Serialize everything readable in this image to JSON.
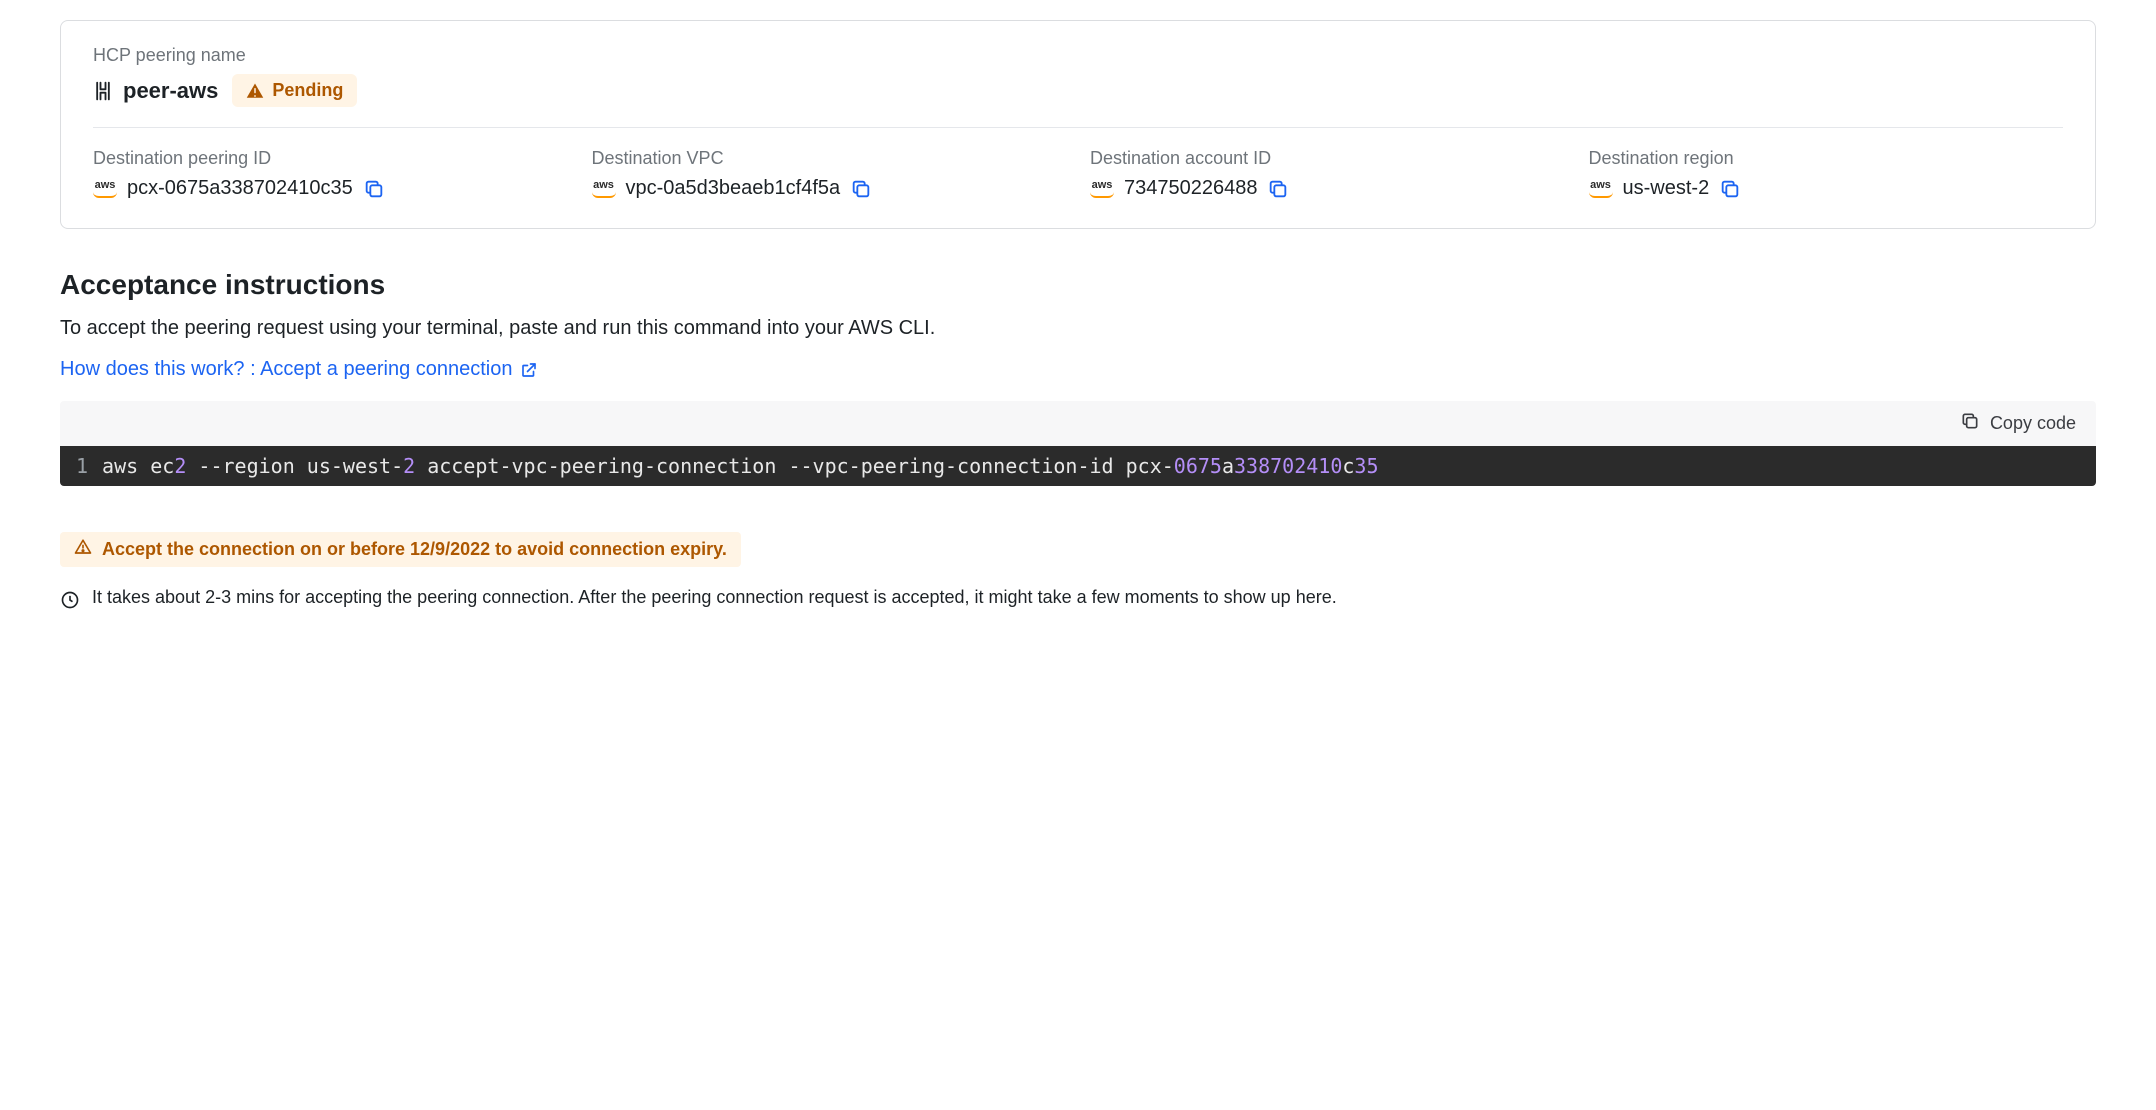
{
  "peering": {
    "name_label": "HCP peering name",
    "name": "peer-aws",
    "status": "Pending",
    "fields": {
      "destination_peering_id": {
        "label": "Destination peering ID",
        "value": "pcx-0675a338702410c35"
      },
      "destination_vpc": {
        "label": "Destination VPC",
        "value": "vpc-0a5d3beaeb1cf4f5a"
      },
      "destination_account_id": {
        "label": "Destination account ID",
        "value": "734750226488"
      },
      "destination_region": {
        "label": "Destination region",
        "value": "us-west-2"
      }
    }
  },
  "instructions": {
    "heading": "Acceptance instructions",
    "body": "To accept the peering request using your terminal, paste and run this command into your AWS CLI.",
    "link_text": "How does this work? : Accept a peering connection"
  },
  "code": {
    "copy_label": "Copy code",
    "line_number": "1",
    "command": "aws ec2 --region us-west-2 accept-vpc-peering-connection --vpc-peering-connection-id pcx-0675a338702410c35"
  },
  "alerts": {
    "expiry": "Accept the connection on or before 12/9/2022 to avoid connection expiry.",
    "timing": "It takes about 2-3 mins for accepting the peering connection. After the peering connection request is accepted, it might take a few moments to show up here."
  },
  "provider": "aws"
}
